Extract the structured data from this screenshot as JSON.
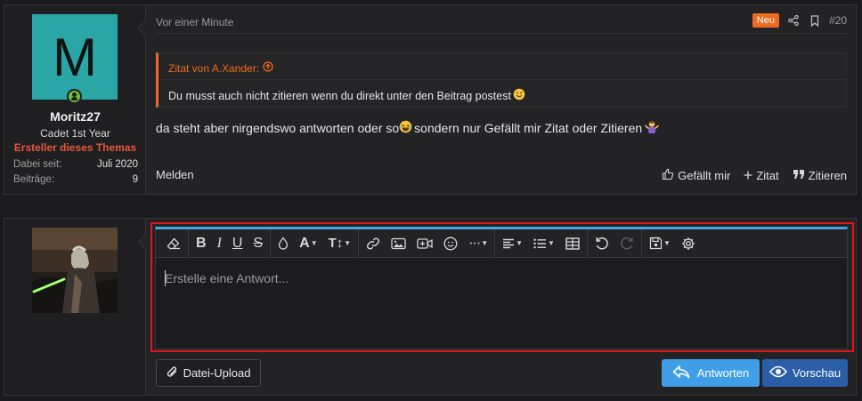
{
  "post": {
    "avatar_letter": "M",
    "user_name": "Moritz27",
    "user_title": "Cadet 1st Year",
    "user_badge": "Ersteller dieses Themas",
    "stats": [
      {
        "label": "Dabei seit:",
        "value": "Juli 2020"
      },
      {
        "label": "Beiträge:",
        "value": "9"
      }
    ],
    "time": "Vor einer Minute",
    "new_badge": "Neu",
    "post_number": "#20",
    "quote_author": "Zitat von A.Xander:",
    "quote_text": "Du musst auch nicht zitieren wenn du direkt unter den Beitrag postest",
    "message_part1": "da steht aber nirgendswo antworten oder so ",
    "message_part2": "sondern nur Gefällt mir Zitat oder Zitieren ",
    "report": "Melden",
    "actions": {
      "like": "Gefällt mir",
      "quote": "Zitat",
      "cite": "Zitieren"
    }
  },
  "reply": {
    "placeholder": "Erstelle eine Antwort...",
    "upload_label": "Datei-Upload",
    "submit_label": "Antworten",
    "preview_label": "Vorschau"
  },
  "colors": {
    "accent_orange": "#ee6a1f",
    "accent_blue": "#3f9ee6",
    "highlight_red": "#e0161b",
    "online_green": "#6fbf3a"
  }
}
